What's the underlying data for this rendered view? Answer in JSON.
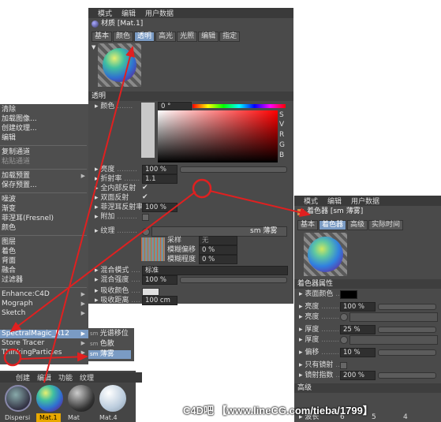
{
  "material_editor": {
    "menu": [
      "模式",
      "编辑",
      "用户数据"
    ],
    "title": "材质 [Mat.1]",
    "tabs": [
      "基本",
      "颜色",
      "透明",
      "高光",
      "光照",
      "编辑",
      "指定"
    ],
    "active_tab": "透明",
    "section": "透明",
    "color_label": "颜色",
    "hue_value": "0 °",
    "channels": [
      "S",
      "V",
      "R",
      "G",
      "B"
    ],
    "channel_values": [
      "",
      "10",
      "25",
      "25",
      "25"
    ],
    "brightness_label": "亮度",
    "brightness_value": "100 %",
    "refraction_label": "折射率",
    "refraction_value": "1.1",
    "total_internal_label": "全内部反射",
    "double_reflect_label": "双面反射",
    "fresnel_label": "菲涅耳反射率",
    "fresnel_value": "100 %",
    "additive_label": "附加",
    "texture_label": "纹理",
    "texture_name": "sm 薄雾",
    "sampling_label": "采样",
    "sampling_value": "无",
    "blur_offset_label": "模糊偏移",
    "blur_offset_value": "0 %",
    "blur_degree_label": "模糊程度",
    "blur_degree_value": "0 %",
    "mix_mode_label": "混合模式",
    "mix_mode_value": "标准",
    "mix_strength_label": "混合强度",
    "mix_strength_value": "100 %",
    "absorb_color_label": "吸收颜色",
    "absorb_distance_label": "吸收距离",
    "absorb_distance_value": "100 cm"
  },
  "context_menu": {
    "items": [
      "清除",
      "加载图像...",
      "创建纹理...",
      "编辑",
      "复制通道",
      "粘贴通道",
      "加载预置",
      "保存预置...",
      "噪波",
      "渐变",
      "菲涅耳(Fresnel)",
      "颜色",
      "图层",
      "着色",
      "背面",
      "融合",
      "过滤器",
      "Enhance:C4D",
      "Mograph",
      "Sketch",
      "SpectralMagic_R12",
      "Store Tracer",
      "ThinkingParticles",
      "多边形"
    ],
    "highlighted": "SpectralMagic_R12",
    "submenu": [
      "光谱移位",
      "色散",
      "薄雾"
    ],
    "submenu_highlighted": "薄雾"
  },
  "shader_panel": {
    "menu": [
      "模式",
      "编辑",
      "用户数据"
    ],
    "title": "着色器 [sm 薄雾]",
    "tabs": [
      "基本",
      "着色器",
      "高级",
      "实际时间"
    ],
    "active_tab": "着色器",
    "section": "着色器属性",
    "surface_color_label": "表面颜色",
    "brightness_label": "亮度",
    "brightness_value": "100 %",
    "brightness2_label": "亮度",
    "thickness_label": "厚度",
    "thickness_value": "25 %",
    "thickness2_label": "厚度",
    "offset_label": "偏移",
    "offset_value": "10 %",
    "only_reflect_label": "只有镜射",
    "reflect_index_label": "镜射指数",
    "reflect_index_value": "200 %",
    "advanced_section": "高级",
    "bottom_labels": [
      "波长",
      "6",
      "5",
      "4"
    ]
  },
  "material_manager": {
    "menu": [
      "创建",
      "编辑",
      "功能",
      "纹理"
    ],
    "materials": [
      "Dispersi",
      "Mat.1",
      "Mat",
      "Mat.4"
    ],
    "selected": "Mat.1"
  },
  "watermark": "C4D吧 【www.lineCG.com/tieba/1799】",
  "colors": {
    "panel": "#4a4a4a",
    "highlight": "#7a9bc4",
    "annotation": "#e02020",
    "selected_material": "#e8a800"
  }
}
